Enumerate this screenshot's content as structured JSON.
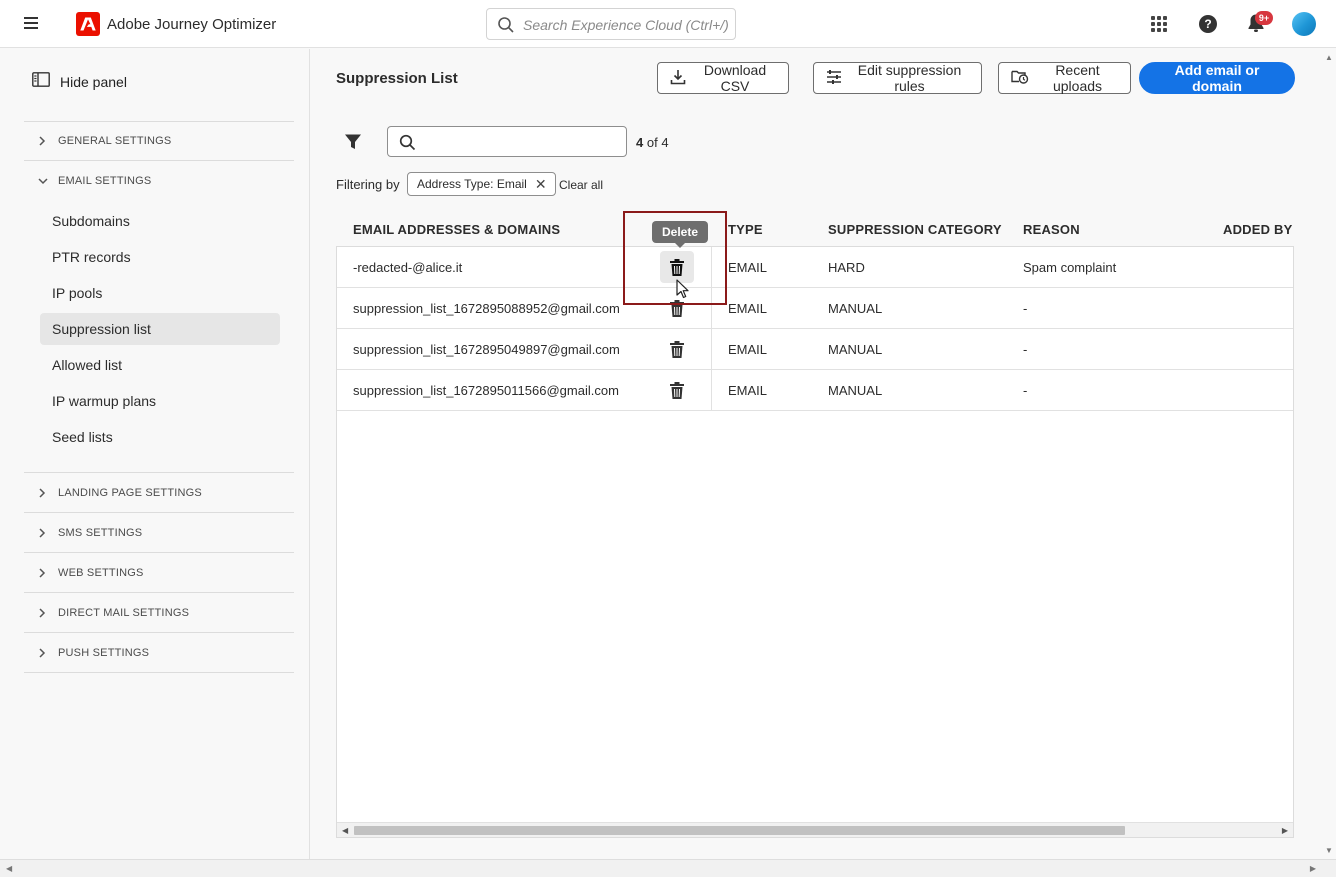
{
  "app": {
    "title": "Adobe Journey Optimizer",
    "search_placeholder": "Search Experience Cloud (Ctrl+/)",
    "notification_badge": "9+",
    "help_label": "?"
  },
  "sidebar": {
    "hide_panel": "Hide panel",
    "sections_top": [
      {
        "label": "GENERAL SETTINGS",
        "expanded": false
      },
      {
        "label": "EMAIL SETTINGS",
        "expanded": true
      }
    ],
    "email_items": [
      {
        "label": "Subdomains"
      },
      {
        "label": "PTR records"
      },
      {
        "label": "IP pools"
      },
      {
        "label": "Suppression list",
        "active": true
      },
      {
        "label": "Allowed list"
      },
      {
        "label": "IP warmup plans"
      },
      {
        "label": "Seed lists"
      }
    ],
    "sections_bottom": [
      {
        "label": "LANDING PAGE SETTINGS"
      },
      {
        "label": "SMS SETTINGS"
      },
      {
        "label": "WEB SETTINGS"
      },
      {
        "label": "DIRECT MAIL SETTINGS"
      },
      {
        "label": "PUSH SETTINGS"
      }
    ]
  },
  "main": {
    "title": "Suppression List",
    "buttons": {
      "download_csv": "Download CSV",
      "edit_rules": "Edit suppression rules",
      "recent_uploads": "Recent uploads",
      "add": "Add email or domain"
    },
    "count_current": "4",
    "count_total": "of 4",
    "filtering_by": "Filtering by",
    "filter_chip": "Address Type: Email",
    "clear_all": "Clear all",
    "tooltip": "Delete",
    "columns": [
      "EMAIL ADDRESSES & DOMAINS",
      "TYPE",
      "SUPPRESSION CATEGORY",
      "REASON",
      "ADDED BY"
    ],
    "rows": [
      {
        "address": "-redacted-@alice.it",
        "type": "EMAIL",
        "category": "HARD",
        "reason": "Spam complaint"
      },
      {
        "address": "suppression_list_1672895088952@gmail.com",
        "type": "EMAIL",
        "category": "MANUAL",
        "reason": "-"
      },
      {
        "address": "suppression_list_1672895049897@gmail.com",
        "type": "EMAIL",
        "category": "MANUAL",
        "reason": "-"
      },
      {
        "address": "suppression_list_1672895011566@gmail.com",
        "type": "EMAIL",
        "category": "MANUAL",
        "reason": "-"
      }
    ]
  },
  "colors": {
    "accent": "#1473e6",
    "brand": "#eb1000",
    "badge": "#d7373f",
    "highlight": "#8b1a1a"
  },
  "icons": [
    "hamburger-icon",
    "adobe-logo-icon",
    "search-icon",
    "apps-grid-icon",
    "help-icon",
    "bell-icon",
    "avatar",
    "panel-icon",
    "chevron-right-icon",
    "chevron-down-icon",
    "download-icon",
    "sliders-icon",
    "folder-clock-icon",
    "filter-icon",
    "trash-icon",
    "close-icon"
  ]
}
